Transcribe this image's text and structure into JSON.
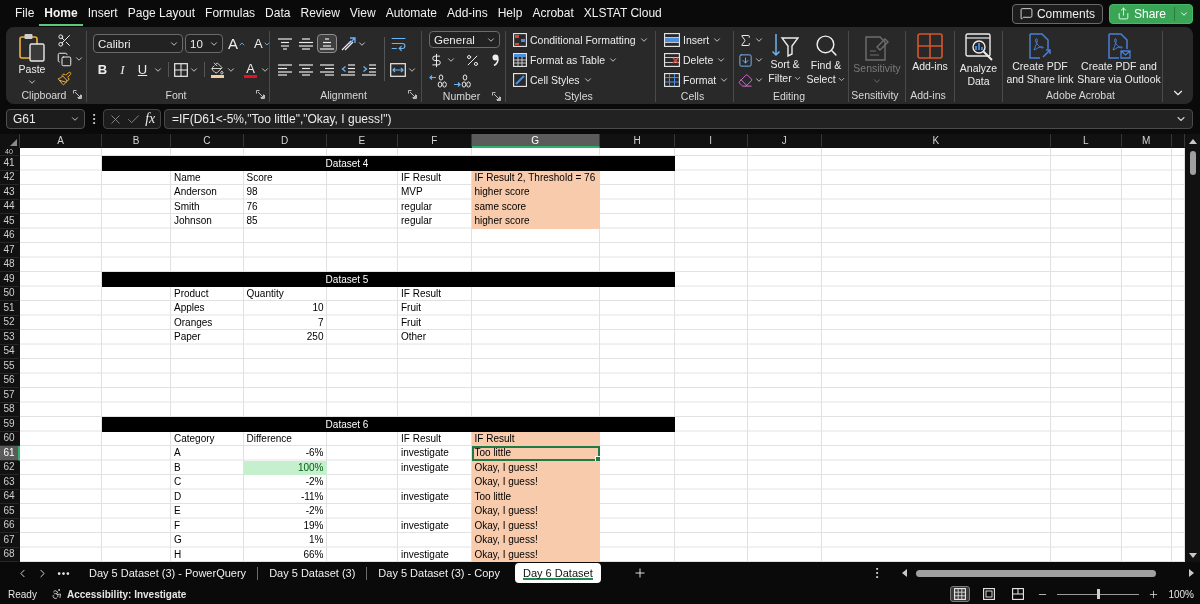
{
  "menu": {
    "tabs": [
      {
        "label": "File",
        "selected": false
      },
      {
        "label": "Home",
        "selected": true
      },
      {
        "label": "Insert",
        "selected": false
      },
      {
        "label": "Page Layout",
        "selected": false
      },
      {
        "label": "Formulas",
        "selected": false
      },
      {
        "label": "Data",
        "selected": false
      },
      {
        "label": "Review",
        "selected": false
      },
      {
        "label": "View",
        "selected": false
      },
      {
        "label": "Automate",
        "selected": false
      },
      {
        "label": "Add-ins",
        "selected": false
      },
      {
        "label": "Help",
        "selected": false
      },
      {
        "label": "Acrobat",
        "selected": false
      },
      {
        "label": "XLSTAT Cloud",
        "selected": false
      }
    ],
    "comments": "Comments",
    "share": "Share"
  },
  "ribbon": {
    "clipboard": {
      "paste": "Paste",
      "label": "Clipboard"
    },
    "font": {
      "font_name": "Calibri",
      "font_size": "10",
      "grow": "A",
      "shrink": "A",
      "bold": "B",
      "italic": "I",
      "underline": "U",
      "font_color": "A",
      "label": "Font"
    },
    "alignment": {
      "vertical": [
        {
          "selected": false
        },
        {
          "selected": false
        },
        {
          "selected": true
        }
      ],
      "horizontal": [
        {
          "selected": false
        },
        {
          "selected": false
        },
        {
          "selected": false
        }
      ],
      "label": "Alignment"
    },
    "number": {
      "format": "General",
      "label": "Number"
    },
    "styles": {
      "items": [
        "Conditional Formatting",
        "Format as Table",
        "Cell Styles"
      ],
      "label": "Styles"
    },
    "cells": {
      "items": [
        "Insert",
        "Delete",
        "Format"
      ],
      "label": "Cells"
    },
    "editing": {
      "sort": [
        "Sort &",
        "Filter"
      ],
      "find": [
        "Find &",
        "Select"
      ],
      "label": "Editing"
    },
    "sensitivity": {
      "button": "Sensitivity",
      "disabled": true,
      "label": "Sensitivity"
    },
    "add_ins": {
      "button": "Add-ins",
      "label": "Add-ins"
    },
    "analyze_data": [
      "Analyze",
      "Data"
    ],
    "acrobat": {
      "buttons": [
        [
          "Create PDF",
          "and Share link"
        ],
        [
          "Create PDF and",
          "Share via Outlook"
        ]
      ],
      "label": "Adobe Acrobat"
    }
  },
  "formula_bar": {
    "name_box": "G61",
    "fx": "fx",
    "formula": "=IF(D61<-5%,\"Too little\",\"Okay, I guess!\")"
  },
  "sheet": {
    "columns": [
      {
        "label": "A",
        "selected": false
      },
      {
        "label": "B",
        "selected": false
      },
      {
        "label": "C",
        "selected": false
      },
      {
        "label": "D",
        "selected": false
      },
      {
        "label": "E",
        "selected": false
      },
      {
        "label": "F",
        "selected": false
      },
      {
        "label": "G",
        "selected": true
      },
      {
        "label": "H",
        "selected": false
      },
      {
        "label": "I",
        "selected": false
      },
      {
        "label": "J",
        "selected": false
      },
      {
        "label": "K",
        "selected": false
      },
      {
        "label": "L",
        "selected": false
      },
      {
        "label": "M",
        "selected": false
      }
    ],
    "rows": [
      {
        "number": "40",
        "selected": false,
        "kind": "cells"
      },
      {
        "number": "41",
        "selected": false,
        "kind": "banner",
        "title": "Dataset 4"
      },
      {
        "number": "42",
        "selected": false,
        "kind": "cells",
        "cells": [
          null,
          null,
          {
            "text": "Name",
            "kind": "text",
            "conditional": false,
            "selected": false
          },
          {
            "text": "Score",
            "kind": "text",
            "conditional": false,
            "selected": false
          },
          null,
          {
            "text": "IF Result",
            "kind": "text",
            "conditional": false,
            "selected": false
          },
          {
            "text": "IF Result 2, Threshold = 76",
            "kind": "text",
            "color": "#f8cbad",
            "conditional": false,
            "selected": false
          }
        ]
      },
      {
        "number": "43",
        "selected": false,
        "kind": "cells",
        "cells": [
          null,
          null,
          {
            "text": "Anderson",
            "kind": "text",
            "conditional": false,
            "selected": false
          },
          {
            "text": "98",
            "kind": "text",
            "conditional": false,
            "selected": false
          },
          null,
          {
            "text": "MVP",
            "kind": "text",
            "conditional": false,
            "selected": false
          },
          {
            "text": "higher score",
            "kind": "text",
            "color": "#f8cbad",
            "conditional": false,
            "selected": false
          }
        ]
      },
      {
        "number": "44",
        "selected": false,
        "kind": "cells",
        "cells": [
          null,
          null,
          {
            "text": "Smith",
            "kind": "text",
            "conditional": false,
            "selected": false
          },
          {
            "text": "76",
            "kind": "text",
            "conditional": false,
            "selected": false
          },
          null,
          {
            "text": "regular",
            "kind": "text",
            "conditional": false,
            "selected": false
          },
          {
            "text": "same score",
            "kind": "text",
            "color": "#f8cbad",
            "conditional": false,
            "selected": false
          }
        ]
      },
      {
        "number": "45",
        "selected": false,
        "kind": "cells",
        "cells": [
          null,
          null,
          {
            "text": "Johnson",
            "kind": "text",
            "conditional": false,
            "selected": false
          },
          {
            "text": "85",
            "kind": "text",
            "conditional": false,
            "selected": false
          },
          null,
          {
            "text": "regular",
            "kind": "text",
            "conditional": false,
            "selected": false
          },
          {
            "text": "higher score",
            "kind": "text",
            "color": "#f8cbad",
            "conditional": false,
            "selected": false
          }
        ]
      },
      {
        "number": "46",
        "selected": false,
        "kind": "cells"
      },
      {
        "number": "47",
        "selected": false,
        "kind": "cells"
      },
      {
        "number": "48",
        "selected": false,
        "kind": "cells"
      },
      {
        "number": "49",
        "selected": false,
        "kind": "banner",
        "title": "Dataset 5"
      },
      {
        "number": "50",
        "selected": false,
        "kind": "cells",
        "cells": [
          null,
          null,
          {
            "text": "Product",
            "kind": "text",
            "conditional": false,
            "selected": false
          },
          {
            "text": "Quantity",
            "kind": "text",
            "conditional": false,
            "selected": false
          },
          null,
          {
            "text": "IF Result",
            "kind": "text",
            "conditional": false,
            "selected": false
          }
        ]
      },
      {
        "number": "51",
        "selected": false,
        "kind": "cells",
        "cells": [
          null,
          null,
          {
            "text": "Apples",
            "kind": "text",
            "conditional": false,
            "selected": false
          },
          {
            "text": "10",
            "kind": "number",
            "conditional": false,
            "selected": false
          },
          null,
          {
            "text": "Fruit",
            "kind": "text",
            "conditional": false,
            "selected": false
          }
        ]
      },
      {
        "number": "52",
        "selected": false,
        "kind": "cells",
        "cells": [
          null,
          null,
          {
            "text": "Oranges",
            "kind": "text",
            "conditional": false,
            "selected": false
          },
          {
            "text": "7",
            "kind": "number",
            "conditional": false,
            "selected": false
          },
          null,
          {
            "text": "Fruit",
            "kind": "text",
            "conditional": false,
            "selected": false
          }
        ]
      },
      {
        "number": "53",
        "selected": false,
        "kind": "cells",
        "cells": [
          null,
          null,
          {
            "text": "Paper",
            "kind": "text",
            "conditional": false,
            "selected": false
          },
          {
            "text": "250",
            "kind": "number",
            "conditional": false,
            "selected": false
          },
          null,
          {
            "text": "Other",
            "kind": "text",
            "conditional": false,
            "selected": false
          }
        ]
      },
      {
        "number": "54",
        "selected": false,
        "kind": "cells"
      },
      {
        "number": "55",
        "selected": false,
        "kind": "cells"
      },
      {
        "number": "56",
        "selected": false,
        "kind": "cells"
      },
      {
        "number": "57",
        "selected": false,
        "kind": "cells"
      },
      {
        "number": "58",
        "selected": false,
        "kind": "cells"
      },
      {
        "number": "59",
        "selected": false,
        "kind": "banner",
        "title": "Dataset 6"
      },
      {
        "number": "60",
        "selected": false,
        "kind": "cells",
        "cells": [
          null,
          null,
          {
            "text": "Category",
            "kind": "text",
            "conditional": false,
            "selected": false
          },
          {
            "text": "Difference",
            "kind": "text",
            "conditional": false,
            "selected": false
          },
          null,
          {
            "text": "IF Result",
            "kind": "text",
            "conditional": false,
            "selected": false
          },
          {
            "text": "IF Result",
            "kind": "text",
            "color": "#f8cbad",
            "conditional": false,
            "selected": false
          }
        ]
      },
      {
        "number": "61",
        "selected": true,
        "kind": "cells",
        "cells": [
          null,
          null,
          {
            "text": "A",
            "kind": "text",
            "conditional": false,
            "selected": false
          },
          {
            "text": "-6%",
            "kind": "number",
            "conditional": false,
            "selected": false
          },
          null,
          {
            "text": "investigate",
            "kind": "text",
            "conditional": false,
            "selected": false
          },
          {
            "text": "Too little",
            "kind": "text",
            "color": "#f8cbad",
            "conditional": false,
            "selected": true
          }
        ]
      },
      {
        "number": "62",
        "selected": false,
        "kind": "cells",
        "cells": [
          null,
          null,
          {
            "text": "B",
            "kind": "text",
            "conditional": false,
            "selected": false
          },
          {
            "text": "100%",
            "kind": "number",
            "color": "#c6efce",
            "conditional": true,
            "selected": false
          },
          null,
          {
            "text": "investigate",
            "kind": "text",
            "conditional": false,
            "selected": false
          },
          {
            "text": "Okay, I guess!",
            "kind": "text",
            "color": "#f8cbad",
            "conditional": false,
            "selected": false
          }
        ]
      },
      {
        "number": "63",
        "selected": false,
        "kind": "cells",
        "cells": [
          null,
          null,
          {
            "text": "C",
            "kind": "text",
            "conditional": false,
            "selected": false
          },
          {
            "text": "-2%",
            "kind": "number",
            "conditional": false,
            "selected": false
          },
          null,
          null,
          {
            "text": "Okay, I guess!",
            "kind": "text",
            "color": "#f8cbad",
            "conditional": false,
            "selected": false
          }
        ]
      },
      {
        "number": "64",
        "selected": false,
        "kind": "cells",
        "cells": [
          null,
          null,
          {
            "text": "D",
            "kind": "text",
            "conditional": false,
            "selected": false
          },
          {
            "text": "-11%",
            "kind": "number",
            "conditional": false,
            "selected": false
          },
          null,
          {
            "text": "investigate",
            "kind": "text",
            "conditional": false,
            "selected": false
          },
          {
            "text": "Too little",
            "kind": "text",
            "color": "#f8cbad",
            "conditional": false,
            "selected": false
          }
        ]
      },
      {
        "number": "65",
        "selected": false,
        "kind": "cells",
        "cells": [
          null,
          null,
          {
            "text": "E",
            "kind": "text",
            "conditional": false,
            "selected": false
          },
          {
            "text": "-2%",
            "kind": "number",
            "conditional": false,
            "selected": false
          },
          null,
          null,
          {
            "text": "Okay, I guess!",
            "kind": "text",
            "color": "#f8cbad",
            "conditional": false,
            "selected": false
          }
        ]
      },
      {
        "number": "66",
        "selected": false,
        "kind": "cells",
        "cells": [
          null,
          null,
          {
            "text": "F",
            "kind": "text",
            "conditional": false,
            "selected": false
          },
          {
            "text": "19%",
            "kind": "number",
            "conditional": false,
            "selected": false
          },
          null,
          {
            "text": "investigate",
            "kind": "text",
            "conditional": false,
            "selected": false
          },
          {
            "text": "Okay, I guess!",
            "kind": "text",
            "color": "#f8cbad",
            "conditional": false,
            "selected": false
          }
        ]
      },
      {
        "number": "67",
        "selected": false,
        "kind": "cells",
        "cells": [
          null,
          null,
          {
            "text": "G",
            "kind": "text",
            "conditional": false,
            "selected": false
          },
          {
            "text": "1%",
            "kind": "number",
            "conditional": false,
            "selected": false
          },
          null,
          null,
          {
            "text": "Okay, I guess!",
            "kind": "text",
            "color": "#f8cbad",
            "conditional": false,
            "selected": false
          }
        ]
      },
      {
        "number": "68",
        "selected": false,
        "kind": "cells",
        "cells": [
          null,
          null,
          {
            "text": "H",
            "kind": "text",
            "conditional": false,
            "selected": false
          },
          {
            "text": "66%",
            "kind": "number",
            "conditional": false,
            "selected": false
          },
          null,
          {
            "text": "investigate",
            "kind": "text",
            "conditional": false,
            "selected": false
          },
          {
            "text": "Okay, I guess!",
            "kind": "text",
            "color": "#f8cbad",
            "conditional": false,
            "selected": false
          }
        ]
      }
    ]
  },
  "sheet_tabs": {
    "tabs": [
      {
        "label": "Day 5 Dataset (3) - PowerQuery",
        "selected": false
      },
      {
        "label": "Day 5 Dataset (3)",
        "selected": false
      },
      {
        "label": "Day 5 Dataset (3) - Copy",
        "selected": false
      },
      {
        "label": "Day 6 Dataset",
        "selected": true
      }
    ]
  },
  "status_bar": {
    "status": "Ready",
    "accessibility": "Accessibility: Investigate",
    "views": [
      {
        "selected": true
      },
      {
        "selected": false
      },
      {
        "selected": false
      }
    ],
    "zoom": {
      "level": 0.5,
      "reading": "100%"
    }
  }
}
